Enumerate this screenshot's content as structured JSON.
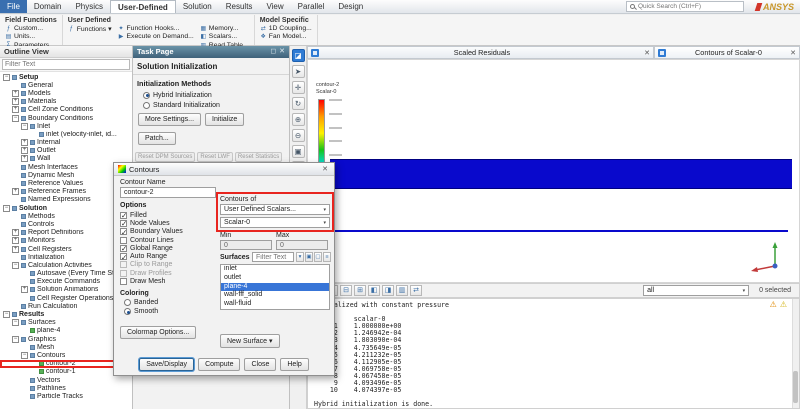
{
  "menubar": {
    "tabs": [
      {
        "label": "File",
        "file": true
      },
      {
        "label": "Domain"
      },
      {
        "label": "Physics"
      },
      {
        "label": "User-Defined",
        "active": true
      },
      {
        "label": "Solution"
      },
      {
        "label": "Results"
      },
      {
        "label": "View"
      },
      {
        "label": "Parallel"
      },
      {
        "label": "Design"
      }
    ],
    "search_placeholder": "Quick Search (Ctrl+F)",
    "logo": "ANSYS"
  },
  "ribbon": {
    "group_labels": [
      "Field Functions",
      "User Defined",
      "Model Specific"
    ],
    "g1c1": [
      {
        "name": "custom-button",
        "glyph": "ƒ",
        "label": "Custom..."
      },
      {
        "name": "units-button",
        "glyph": "▤",
        "label": "Units..."
      },
      {
        "name": "parameters-button",
        "glyph": "Σ",
        "label": "Parameters..."
      }
    ],
    "g2c1": [
      {
        "name": "functions-menu-button",
        "glyph": "ƒ",
        "label": "Functions ▾"
      }
    ],
    "g2c2": [
      {
        "name": "function-hooks-button",
        "glyph": "✦",
        "label": "Function Hooks..."
      },
      {
        "name": "execute-on-demand-button",
        "glyph": "▶",
        "label": "Execute on Demand..."
      }
    ],
    "g2c3": [
      {
        "name": "memory-button",
        "glyph": "▦",
        "label": "Memory..."
      },
      {
        "name": "scalars-button",
        "glyph": "◧",
        "label": "Scalars..."
      },
      {
        "name": "read-table-button",
        "glyph": "▥",
        "label": "Read Table..."
      }
    ],
    "g3c1": [
      {
        "name": "1d-coupling-button",
        "glyph": "⇄",
        "label": "1D Coupling..."
      },
      {
        "name": "fan-model-button",
        "glyph": "❖",
        "label": "Fan Model..."
      }
    ]
  },
  "outline": {
    "title": "Outline View",
    "filter_placeholder": "Filter Text",
    "tree": [
      {
        "label": "Setup",
        "level": 0,
        "expand": "−",
        "bold": true
      },
      {
        "label": "General",
        "level": 1
      },
      {
        "label": "Models",
        "level": 1,
        "expand": "+"
      },
      {
        "label": "Materials",
        "level": 1,
        "expand": "+"
      },
      {
        "label": "Cell Zone Conditions",
        "level": 1,
        "expand": "+"
      },
      {
        "label": "Boundary Conditions",
        "level": 1,
        "expand": "−"
      },
      {
        "label": "Inlet",
        "level": 2,
        "expand": "−"
      },
      {
        "label": "inlet (velocity-inlet, id...",
        "level": 3
      },
      {
        "label": "Internal",
        "level": 2,
        "expand": "+"
      },
      {
        "label": "Outlet",
        "level": 2,
        "expand": "+"
      },
      {
        "label": "Wall",
        "level": 2,
        "expand": "+"
      },
      {
        "label": "Mesh Interfaces",
        "level": 1
      },
      {
        "label": "Dynamic Mesh",
        "level": 1
      },
      {
        "label": "Reference Values",
        "level": 1
      },
      {
        "label": "Reference Frames",
        "level": 1,
        "expand": "+"
      },
      {
        "label": "Named Expressions",
        "level": 1
      },
      {
        "label": "Solution",
        "level": 0,
        "expand": "−",
        "bold": true
      },
      {
        "label": "Methods",
        "level": 1
      },
      {
        "label": "Controls",
        "level": 1
      },
      {
        "label": "Report Definitions",
        "level": 1,
        "expand": "+"
      },
      {
        "label": "Monitors",
        "level": 1,
        "expand": "+"
      },
      {
        "label": "Cell Registers",
        "level": 1,
        "expand": "+"
      },
      {
        "label": "Initialization",
        "level": 1
      },
      {
        "label": "Calculation Activities",
        "level": 1,
        "expand": "−"
      },
      {
        "label": "Autosave (Every Time Step)",
        "level": 2
      },
      {
        "label": "Execute Commands",
        "level": 2
      },
      {
        "label": "Solution Animations",
        "level": 2,
        "expand": "+"
      },
      {
        "label": "Cell Register Operations",
        "level": 2
      },
      {
        "label": "Run Calculation",
        "level": 1
      },
      {
        "label": "Results",
        "level": 0,
        "expand": "−",
        "bold": true
      },
      {
        "label": "Surfaces",
        "level": 1,
        "expand": "−"
      },
      {
        "label": "plane-4",
        "level": 2,
        "green": true
      },
      {
        "label": "Graphics",
        "level": 1,
        "expand": "−"
      },
      {
        "label": "Mesh",
        "level": 2
      },
      {
        "label": "Contours",
        "level": 2,
        "expand": "−"
      },
      {
        "label": "contour-2",
        "level": 3,
        "green": true,
        "highlight": true
      },
      {
        "label": "contour-1",
        "level": 3,
        "green": true
      },
      {
        "label": "Vectors",
        "level": 2
      },
      {
        "label": "Pathlines",
        "level": 2
      },
      {
        "label": "Particle Tracks",
        "level": 2
      }
    ]
  },
  "task_page": {
    "header": "Task Page",
    "title": "Solution Initialization",
    "section": "Initialization Methods",
    "methods": [
      {
        "label": "Hybrid Initialization",
        "selected": true
      },
      {
        "label": "Standard Initialization"
      }
    ],
    "more_settings": "More Settings...",
    "initialize": "Initialize",
    "patch": "Patch...",
    "reset_buttons": [
      "Reset DPM Sources",
      "Reset LWF",
      "Reset Statistics"
    ]
  },
  "dialog": {
    "title": "Contours",
    "name_label": "Contour Name",
    "contour_name": "contour-2",
    "options_label": "Options",
    "options": [
      {
        "label": "Filled",
        "checked": true
      },
      {
        "label": "Node Values",
        "checked": true
      },
      {
        "label": "Boundary Values",
        "checked": true
      },
      {
        "label": "Contour Lines"
      },
      {
        "label": "Global Range",
        "checked": true
      },
      {
        "label": "Auto Range",
        "checked": true
      },
      {
        "label": "Clip to Range",
        "disabled": true
      },
      {
        "label": "Draw Profiles",
        "disabled": true
      },
      {
        "label": "Draw Mesh"
      }
    ],
    "contours_of_label": "Contours of",
    "field_category": "User Defined Scalars...",
    "field_variable": "Scalar-0",
    "min_label": "Min",
    "max_label": "Max",
    "min_value": "0",
    "max_value": "0",
    "surfaces_label": "Surfaces",
    "surfaces_filter_placeholder": "Filter Text",
    "surface_tools": [
      {
        "name": "surface-filter-menu-icon",
        "glyph": "▾"
      },
      {
        "name": "surface-select-all-icon",
        "glyph": "▣"
      },
      {
        "name": "surface-clear-selection-icon",
        "glyph": "▢"
      },
      {
        "name": "surface-group-icon",
        "glyph": "≡"
      }
    ],
    "surfaces": [
      {
        "label": "inlet"
      },
      {
        "label": "outlet"
      },
      {
        "label": "plane-4",
        "selected": true
      },
      {
        "label": "wall-fff_solid"
      },
      {
        "label": "wall-fluid"
      }
    ],
    "coloring_label": "Coloring",
    "coloring": [
      {
        "label": "Banded"
      },
      {
        "label": "Smooth",
        "selected": true
      }
    ],
    "colormap_button": "Colormap Options...",
    "new_surface_button": "New Surface ▾",
    "footer_buttons": [
      {
        "label": "Save/Display",
        "primary": true
      },
      {
        "label": "Compute"
      },
      {
        "label": "Close"
      },
      {
        "label": "Help"
      }
    ]
  },
  "graphics": {
    "windows": [
      {
        "title": "Scaled Residuals"
      },
      {
        "title": "Contours of Scalar-0",
        "active": true
      }
    ],
    "legend_title": "contour-2",
    "legend_subtitle": "Scalar-0",
    "side_tools_top": [
      {
        "name": "window-dock-icon",
        "glyph": "◪",
        "blue": true
      },
      {
        "name": "pointer-icon",
        "glyph": "➤"
      },
      {
        "name": "pan-icon",
        "glyph": "✛"
      },
      {
        "name": "rotate-icon",
        "glyph": "↻"
      },
      {
        "name": "zoom-in-icon",
        "glyph": "⊕"
      },
      {
        "name": "zoom-out-icon",
        "glyph": "⊖"
      },
      {
        "name": "fit-to-window-icon",
        "glyph": "▣"
      },
      {
        "name": "box-zoom-icon",
        "glyph": "◧"
      },
      {
        "name": "annotate-icon",
        "glyph": "✎"
      },
      {
        "name": "views-icon",
        "glyph": "▦"
      },
      {
        "name": "lights-icon",
        "glyph": "☀"
      }
    ],
    "side_tools_bottom": [
      {
        "name": "console-copy-icon",
        "glyph": "▤"
      },
      {
        "name": "console-clear-icon",
        "glyph": "▥"
      }
    ],
    "bottom_tools": [
      {
        "name": "window-single-icon",
        "glyph": "▣"
      },
      {
        "name": "window-split-horizontal-icon",
        "glyph": "◫"
      },
      {
        "name": "window-split-vertical-icon",
        "glyph": "⊟"
      },
      {
        "name": "window-grid-icon",
        "glyph": "⊞"
      },
      {
        "name": "window-left-icon",
        "glyph": "◧"
      },
      {
        "name": "window-right-icon",
        "glyph": "◨"
      },
      {
        "name": "window-save-icon",
        "glyph": "▥"
      },
      {
        "name": "window-sync-icon",
        "glyph": "⇄"
      }
    ],
    "display_filter": "all",
    "selection_status": "0 selected"
  },
  "console": {
    "warning_icons": [
      {
        "name": "warning-icon",
        "glyph": "⚠"
      },
      {
        "name": "caution-icon",
        "glyph": "⚠"
      }
    ],
    "lines": [
      "initialized with constant pressure",
      "",
      "          scalar-0",
      "     1    1.000000e+00",
      "     2    1.246942e-04",
      "     3    1.803090e-04",
      "     4    4.735649e-05",
      "     5    4.211232e-05",
      "     6    4.112905e-05",
      "     7    4.069758e-05",
      "     8    4.067458e-05",
      "     9    4.093496e-05",
      "    10    4.074397e-05",
      "",
      "Hybrid initialization is done."
    ]
  }
}
